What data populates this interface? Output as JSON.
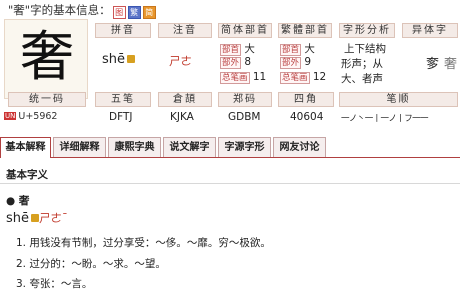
{
  "page": {
    "title_prefix": "\"奢\"字的基本信息：",
    "mini_icons": [
      "图",
      "繁",
      "简"
    ]
  },
  "char": {
    "glyph": "奢",
    "unicode": "U+5962",
    "unicode_tag": "UN"
  },
  "headers": {
    "pinyin": "拼音",
    "zhuyin": "注音",
    "simple_radical": "简体部首",
    "trad_radical": "繁體部首",
    "structure": "字形分析",
    "variant": "异体字",
    "unicode": "统一码",
    "wubi": "五笔",
    "cangjie": "倉頡",
    "zhengma": "郑码",
    "sijiao": "四角",
    "bishun": "笔顺"
  },
  "values": {
    "pinyin": "shē",
    "zhuyin": "ㄕㄜ",
    "simple": {
      "radical_label": "部首",
      "radical": "大",
      "outer_label": "部外",
      "outer": "8",
      "total_label": "总笔画",
      "total": "11"
    },
    "trad": {
      "radical_label": "部首",
      "radical": "大",
      "outer_label": "部外",
      "outer": "9",
      "total_label": "总笔画",
      "total": "12"
    },
    "structure_line1": "上下结构",
    "structure_line2": "形声；从",
    "structure_line3": "大、者声",
    "variant": "奓",
    "variant2": "奢",
    "wubi": "DFTJ",
    "cangjie": "KJKA",
    "zhengma": "GDBM",
    "sijiao": "40604",
    "bishun": "一ノ丶一丨一ノ丨フ一一"
  },
  "tabs": [
    "基本解释",
    "详细解释",
    "康熙字典",
    "说文解字",
    "字源字形",
    "网友讨论"
  ],
  "content": {
    "section_title": "基本字义",
    "bullet": "● 奢",
    "pinyin": "shē",
    "zhuyin": "ㄕㄜˉ",
    "defs": [
      "1. 用钱没有节制，过分享受：～侈。～靡。穷～极欲。",
      "2. 过分的：～盼。～求。～望。",
      "3. 夸张：～言。"
    ]
  }
}
